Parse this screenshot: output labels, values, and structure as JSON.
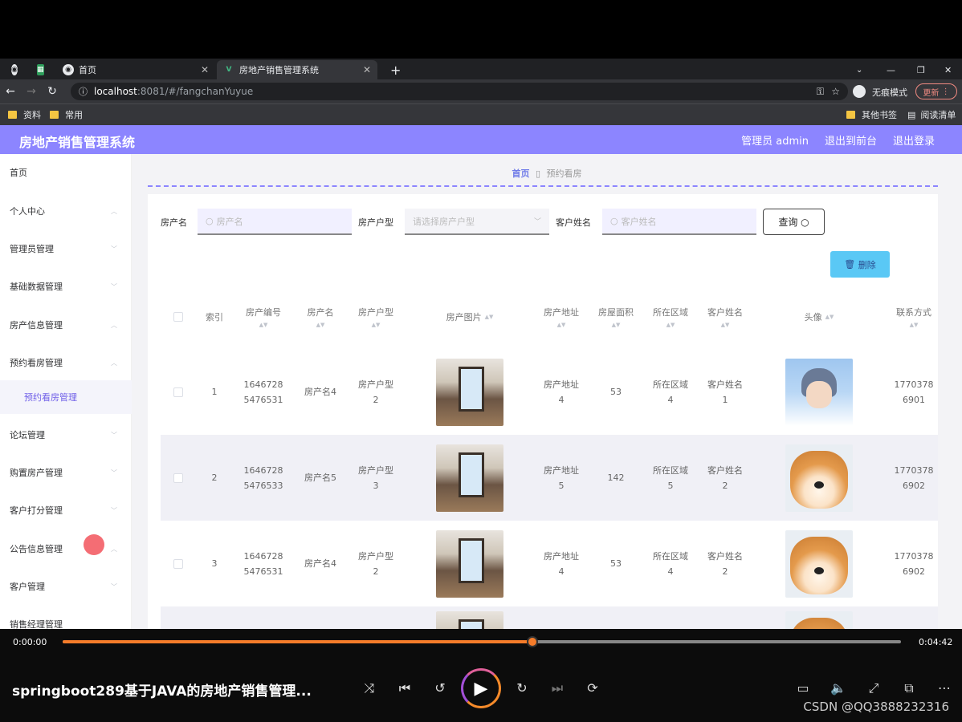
{
  "browser": {
    "tabs": [
      {
        "label": "首页"
      },
      {
        "label": "房地产销售管理系统"
      }
    ],
    "url_host": "localhost",
    "url_path": ":8081/#/fangchanYuyue",
    "incognito_label": "无痕模式",
    "update_label": "更新",
    "bookmarks": [
      "资料",
      "常用"
    ],
    "bookmarks_right": [
      "其他书签",
      "阅读清单"
    ]
  },
  "app": {
    "title": "房地产销售管理系统",
    "header_links": [
      "管理员 admin",
      "退出到前台",
      "退出登录"
    ]
  },
  "sidebar": {
    "items": [
      "首页",
      "个人中心",
      "管理员管理",
      "基础数据管理",
      "房产信息管理",
      "预约看房管理",
      "预约看房管理",
      "论坛管理",
      "购置房产管理",
      "客户打分管理",
      "公告信息管理",
      "客户管理",
      "销售经理管理"
    ]
  },
  "breadcrumb": {
    "home": "首页",
    "current": "预约看房"
  },
  "search": {
    "name_label": "房产名",
    "name_placeholder": "房产名",
    "type_label": "房产户型",
    "type_placeholder": "请选择房产户型",
    "customer_label": "客户姓名",
    "customer_placeholder": "客户姓名",
    "query_label": "查询"
  },
  "delete_label": "删除",
  "table": {
    "headers": [
      "索引",
      "房产编号",
      "房产名",
      "房产户型",
      "房产图片",
      "房产地址",
      "房屋面积",
      "所在区域",
      "客户姓名",
      "头像",
      "联系方式"
    ],
    "rows": [
      {
        "index": "1",
        "code1": "1646728",
        "code2": "5476531",
        "name": "房产名4",
        "type1": "房产户型",
        "type2": "2",
        "addr1": "房产地址",
        "addr2": "4",
        "area": "53",
        "region1": "所在区域",
        "region2": "4",
        "cust1": "客户姓名",
        "cust2": "1",
        "phone1": "1770378",
        "phone2": "6901",
        "avatar": "boy"
      },
      {
        "index": "2",
        "code1": "1646728",
        "code2": "5476533",
        "name": "房产名5",
        "type1": "房产户型",
        "type2": "3",
        "addr1": "房产地址",
        "addr2": "5",
        "area": "142",
        "region1": "所在区域",
        "region2": "5",
        "cust1": "客户姓名",
        "cust2": "2",
        "phone1": "1770378",
        "phone2": "6902",
        "avatar": "dog"
      },
      {
        "index": "3",
        "code1": "1646728",
        "code2": "5476531",
        "name": "房产名4",
        "type1": "房产户型",
        "type2": "2",
        "addr1": "房产地址",
        "addr2": "4",
        "area": "53",
        "region1": "所在区域",
        "region2": "4",
        "cust1": "客户姓名",
        "cust2": "2",
        "phone1": "1770378",
        "phone2": "6902",
        "avatar": "dog"
      }
    ]
  },
  "player": {
    "current_time": "0:00:00",
    "duration": "0:04:42",
    "progress_fraction": 0.56,
    "video_title": "springboot289基于JAVA的房地产销售管理...",
    "watermark": "CSDN @QQ3888232316"
  }
}
